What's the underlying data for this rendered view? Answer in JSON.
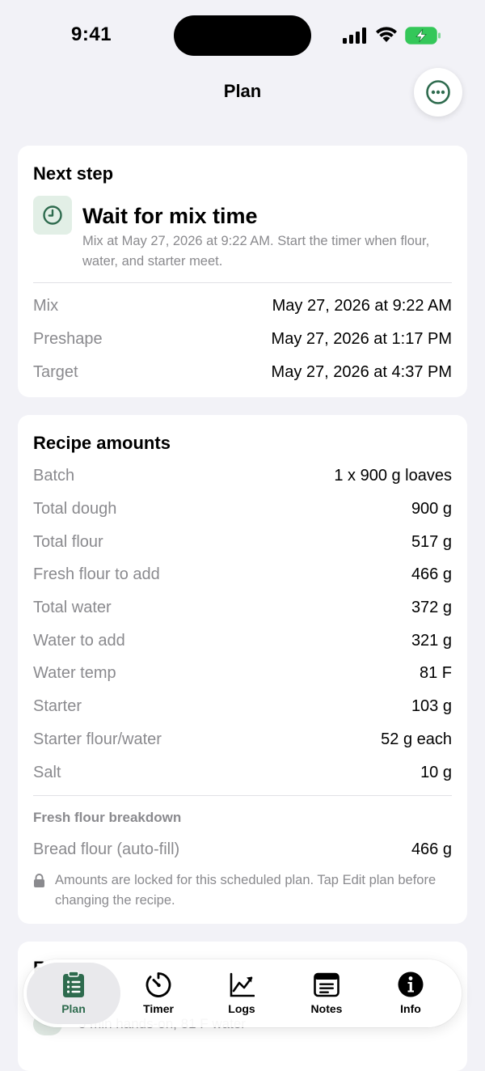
{
  "status_bar": {
    "time": "9:41"
  },
  "nav": {
    "title": "Plan",
    "more_icon": "ellipsis-circle-icon"
  },
  "next_step": {
    "title": "Next step",
    "icon": "clock-icon",
    "step_title": "Wait for mix time",
    "step_description": "Mix at May 27, 2026 at 9:22 AM. Start the timer when flour, water, and starter meet.",
    "schedule": [
      {
        "label": "Mix",
        "value": "May 27, 2026 at 9:22 AM"
      },
      {
        "label": "Preshape",
        "value": "May 27, 2026 at 1:17 PM"
      },
      {
        "label": "Target",
        "value": "May 27, 2026 at 4:37 PM"
      }
    ]
  },
  "recipe": {
    "title": "Recipe amounts",
    "rows": [
      {
        "label": "Batch",
        "value": "1 x 900 g loaves"
      },
      {
        "label": "Total dough",
        "value": "900 g"
      },
      {
        "label": "Total flour",
        "value": "517 g"
      },
      {
        "label": "Fresh flour to add",
        "value": "466 g"
      },
      {
        "label": "Total water",
        "value": "372 g"
      },
      {
        "label": "Water to add",
        "value": "321 g"
      },
      {
        "label": "Water temp",
        "value": "81 F"
      },
      {
        "label": "Starter",
        "value": "103 g"
      },
      {
        "label": "Starter flour/water",
        "value": "52 g each"
      },
      {
        "label": "Salt",
        "value": "10 g"
      }
    ],
    "breakdown_heading": "Fresh flour breakdown",
    "breakdown_rows": [
      {
        "label": "Bread flour (auto-fill)",
        "value": "466 g"
      }
    ],
    "lock_icon": "lock-icon",
    "lock_note": "Amounts are locked for this scheduled plan. Tap Edit plan before changing the recipe."
  },
  "third_card": {
    "title": "F",
    "subtitle": "5 min hands-on, 81 F water"
  },
  "tabs": [
    {
      "label": "Plan",
      "icon": "clipboard-list-icon",
      "active": true
    },
    {
      "label": "Timer",
      "icon": "timer-icon",
      "active": false
    },
    {
      "label": "Logs",
      "icon": "chart-line-icon",
      "active": false
    },
    {
      "label": "Notes",
      "icon": "notes-icon",
      "active": false
    },
    {
      "label": "Info",
      "icon": "info-circle-icon",
      "active": false
    }
  ],
  "colors": {
    "accent": "#2e6b4e",
    "background": "#f2f2f7",
    "secondary_text": "#8a8a8e"
  }
}
